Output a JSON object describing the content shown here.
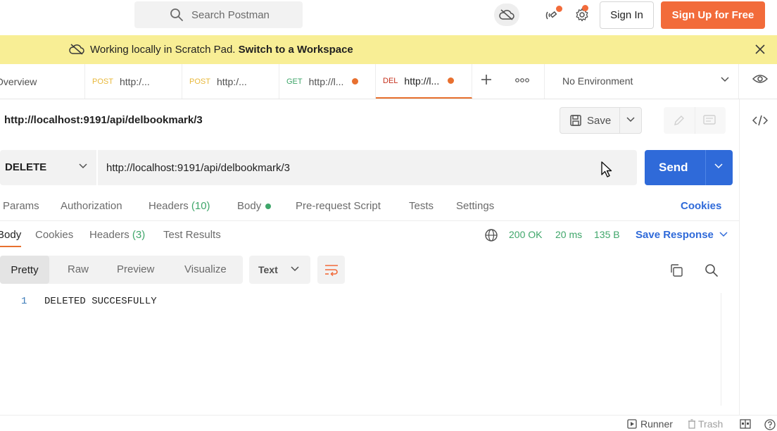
{
  "header": {
    "search_placeholder": "Search Postman",
    "sign_in": "Sign In",
    "sign_up": "Sign Up for Free"
  },
  "banner": {
    "message": "Working locally in Scratch Pad.",
    "link": "Switch to a Workspace"
  },
  "tabs": [
    {
      "method": "",
      "label": "Overview",
      "unsaved": false
    },
    {
      "method": "POST",
      "label": "http:/...",
      "unsaved": false
    },
    {
      "method": "POST",
      "label": "http:/...",
      "unsaved": false
    },
    {
      "method": "GET",
      "label": "http://l...",
      "unsaved": true
    },
    {
      "method": "DEL",
      "label": "http://l...",
      "unsaved": true,
      "active": true
    }
  ],
  "environment": {
    "selected": "No Environment"
  },
  "request": {
    "title": "http://localhost:9191/api/delbookmark/3",
    "save_label": "Save",
    "method": "DELETE",
    "url": "http://localhost:9191/api/delbookmark/3",
    "send_label": "Send",
    "subtabs": {
      "params": "Params",
      "authorization": "Authorization",
      "headers": "Headers",
      "headers_count": "(10)",
      "body": "Body",
      "prerequest": "Pre-request Script",
      "tests": "Tests",
      "settings": "Settings"
    },
    "cookies_link": "Cookies"
  },
  "response": {
    "tabs": {
      "body": "Body",
      "cookies": "Cookies",
      "headers": "Headers",
      "headers_count": "(3)",
      "test_results": "Test Results"
    },
    "status": "200 OK",
    "time": "20 ms",
    "size": "135 B",
    "save_response": "Save Response",
    "formats": {
      "pretty": "Pretty",
      "raw": "Raw",
      "preview": "Preview",
      "visualize": "Visualize"
    },
    "type": "Text",
    "line_number": "1",
    "body": "DELETED SUCCESFULLY"
  },
  "statusbar": {
    "runner": "Runner",
    "trash": "Trash"
  },
  "colors": {
    "accent": "#f26b3a",
    "primary_blue": "#2f6ad9",
    "success_green": "#3fa66a",
    "banner_yellow": "#f8ee95"
  }
}
